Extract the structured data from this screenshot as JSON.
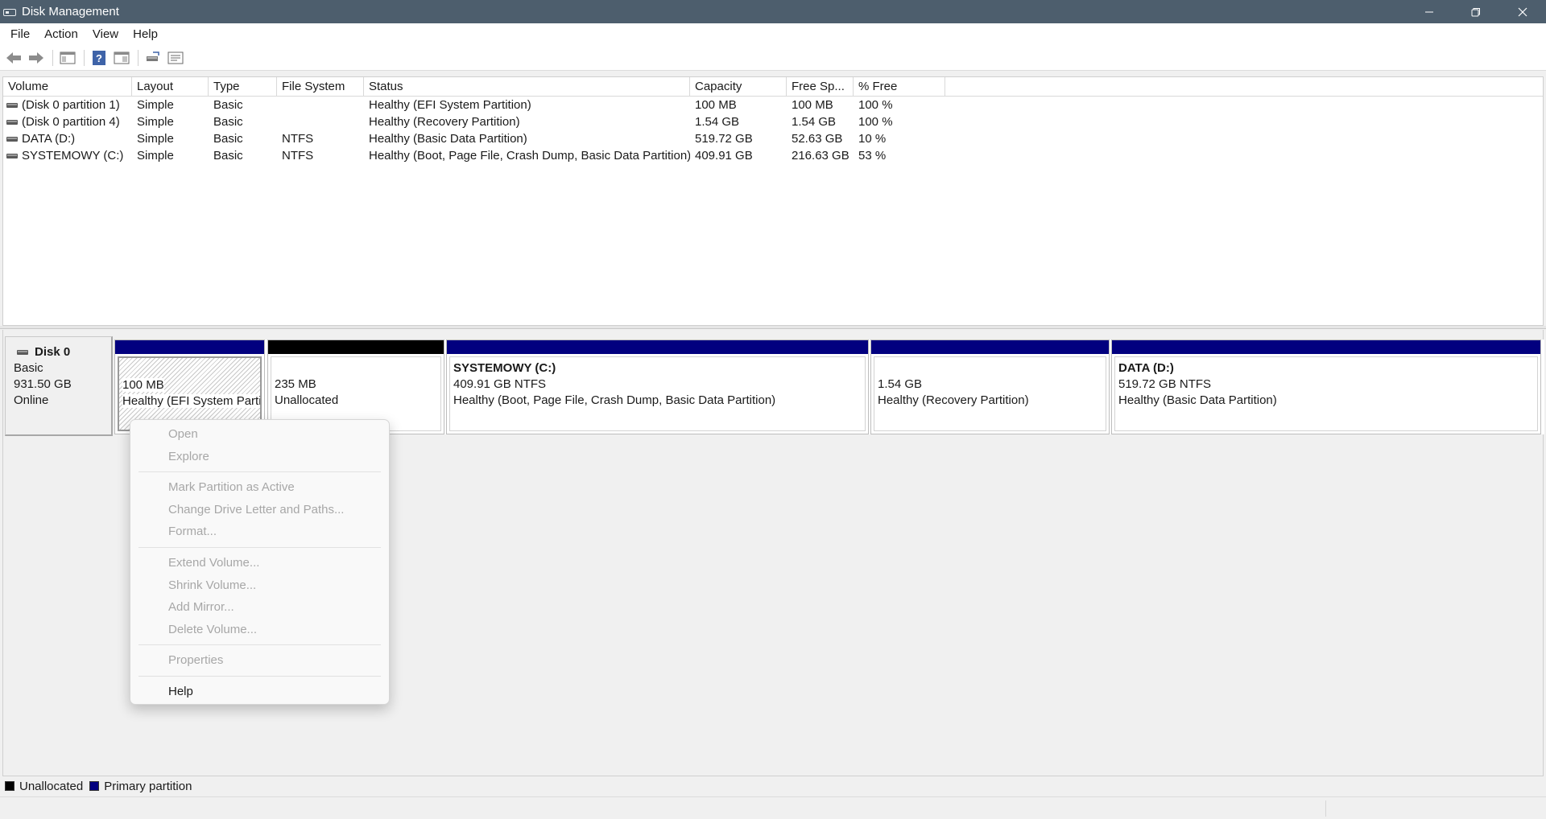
{
  "window": {
    "title": "Disk Management",
    "app_icon": "disk-management-icon",
    "controls": [
      "minimize-icon",
      "restore-icon",
      "close-icon"
    ]
  },
  "menu": {
    "items": [
      "File",
      "Action",
      "View",
      "Help"
    ]
  },
  "toolbar": {
    "buttons": [
      "back-arrow-icon",
      "forward-arrow-icon",
      "console-tree-icon",
      "help-icon",
      "show-hide-action-pane-icon",
      "rescan-disks-icon",
      "properties-icon"
    ]
  },
  "volume_list": {
    "columns": [
      "Volume",
      "Layout",
      "Type",
      "File System",
      "Status",
      "Capacity",
      "Free Sp...",
      "% Free"
    ],
    "rows": [
      {
        "volume": "(Disk 0 partition 1)",
        "layout": "Simple",
        "type": "Basic",
        "fs": "",
        "status": "Healthy (EFI System Partition)",
        "capacity": "100 MB",
        "free": "100 MB",
        "pct": "100 %"
      },
      {
        "volume": "(Disk 0 partition 4)",
        "layout": "Simple",
        "type": "Basic",
        "fs": "",
        "status": "Healthy (Recovery Partition)",
        "capacity": "1.54 GB",
        "free": "1.54 GB",
        "pct": "100 %"
      },
      {
        "volume": "DATA (D:)",
        "layout": "Simple",
        "type": "Basic",
        "fs": "NTFS",
        "status": "Healthy (Basic Data Partition)",
        "capacity": "519.72 GB",
        "free": "52.63 GB",
        "pct": "10 %"
      },
      {
        "volume": "SYSTEMOWY (C:)",
        "layout": "Simple",
        "type": "Basic",
        "fs": "NTFS",
        "status": "Healthy (Boot, Page File, Crash Dump, Basic Data Partition)",
        "capacity": "409.91 GB",
        "free": "216.63 GB",
        "pct": "53 %"
      }
    ]
  },
  "disk": {
    "name": "Disk 0",
    "kind": "Basic",
    "size": "931.50 GB",
    "state": "Online"
  },
  "partitions": [
    {
      "name": "",
      "line1": "100 MB",
      "line2": "Healthy (EFI System Partiti",
      "kind": "primary",
      "selected": true
    },
    {
      "name": "",
      "line1": "235 MB",
      "line2": "Unallocated",
      "kind": "unallocated",
      "selected": false
    },
    {
      "name": "SYSTEMOWY  (C:)",
      "line1": "409.91 GB NTFS",
      "line2": "Healthy (Boot, Page File, Crash Dump, Basic Data Partition)",
      "kind": "primary",
      "selected": false
    },
    {
      "name": "",
      "line1": "1.54 GB",
      "line2": "Healthy (Recovery Partition)",
      "kind": "primary",
      "selected": false
    },
    {
      "name": "DATA  (D:)",
      "line1": "519.72 GB NTFS",
      "line2": "Healthy (Basic Data Partition)",
      "kind": "primary",
      "selected": false
    }
  ],
  "context_menu": {
    "items": [
      {
        "label": "Open",
        "enabled": false
      },
      {
        "label": "Explore",
        "enabled": false
      },
      {
        "separator": true
      },
      {
        "label": "Mark Partition as Active",
        "enabled": false
      },
      {
        "label": "Change Drive Letter and Paths...",
        "enabled": false
      },
      {
        "label": "Format...",
        "enabled": false
      },
      {
        "separator": true
      },
      {
        "label": "Extend Volume...",
        "enabled": false
      },
      {
        "label": "Shrink Volume...",
        "enabled": false
      },
      {
        "label": "Add Mirror...",
        "enabled": false
      },
      {
        "label": "Delete Volume...",
        "enabled": false
      },
      {
        "separator": true
      },
      {
        "label": "Properties",
        "enabled": false
      },
      {
        "separator": true
      },
      {
        "label": "Help",
        "enabled": true
      }
    ]
  },
  "legend": {
    "unallocated_label": "Unallocated",
    "primary_label": "Primary partition",
    "unallocated_color": "#000000",
    "primary_color": "#02007f"
  }
}
